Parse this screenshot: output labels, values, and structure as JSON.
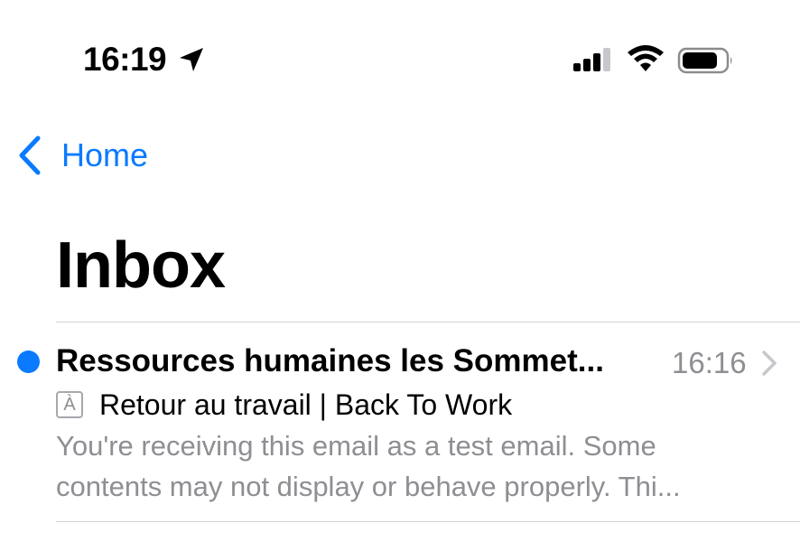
{
  "status_bar": {
    "time": "16:19",
    "icons": [
      "location-arrow-icon",
      "cellular-signal-icon",
      "wifi-icon",
      "battery-icon"
    ]
  },
  "nav": {
    "back_label": "Home"
  },
  "page": {
    "title": "Inbox"
  },
  "messages": [
    {
      "sender": "Ressources humaines les Sommet...",
      "time": "16:16",
      "subject": "Retour au travail | Back To Work",
      "subject_icon_glyph": "À",
      "preview_lines": [
        "You're receiving this email as a test email. Some",
        "contents may not display or behave properly. Thi..."
      ],
      "unread": true
    }
  ],
  "colors": {
    "accent": "#0a7aff",
    "secondary_text": "#8e8e93",
    "divider": "#d4d4d8"
  }
}
